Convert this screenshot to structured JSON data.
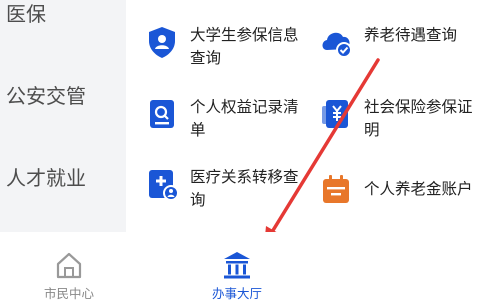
{
  "sidebar": {
    "categories": [
      "医保",
      "公安交管",
      "人才就业"
    ]
  },
  "services": [
    {
      "label": "大学生参保信息查询",
      "line1": "大学生参保信息",
      "line2": "查询",
      "icon": "shield-person-icon"
    },
    {
      "label": "养老待遇查询",
      "line1": "养老待遇查询",
      "line2": "",
      "icon": "cloud-check-icon"
    },
    {
      "label": "个人权益记录清单",
      "line1": "个人权益记录清",
      "line2": "单",
      "icon": "document-search-icon"
    },
    {
      "label": "社会保险参保证明",
      "line1": "社会保险参保证",
      "line2": "明",
      "icon": "yuan-document-icon"
    },
    {
      "label": "医疗关系转移查询",
      "line1": "医疗关系转移查",
      "line2": "询",
      "icon": "medical-transfer-icon"
    },
    {
      "label": "个人养老金账户",
      "line1": "个人养老金账户",
      "line2": "",
      "icon": "calendar-account-icon"
    }
  ],
  "tabbar": {
    "tabs": [
      {
        "label": "市民中心",
        "icon": "home-icon",
        "active": false
      },
      {
        "label": "办事大厅",
        "icon": "government-hall-icon",
        "active": true
      }
    ]
  },
  "colors": {
    "accent": "#1a56d6",
    "icon_orange": "#e8772a",
    "annotation_arrow": "#e53935"
  }
}
